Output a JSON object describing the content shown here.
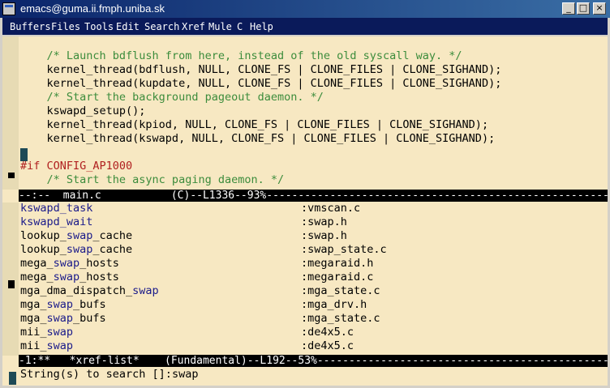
{
  "window": {
    "title": "emacs@guma.ii.fmph.uniba.sk"
  },
  "titlebar_buttons": {
    "minimize": "_",
    "maximize": "□",
    "close": "×"
  },
  "menubar": {
    "items": [
      "Buffers",
      "Files",
      "Tools",
      "Edit",
      "Search",
      "Xref",
      "Mule",
      "C",
      "Help"
    ]
  },
  "top_window": {
    "lines": [
      "",
      "    /* Launch bdflush from here, instead of the old syscall way. */",
      "    kernel_thread(bdflush, NULL, CLONE_FS | CLONE_FILES | CLONE_SIGHAND);",
      "    kernel_thread(kupdate, NULL, CLONE_FS | CLONE_FILES | CLONE_SIGHAND);",
      "    /* Start the background pageout daemon. */",
      "    kswapd_setup();",
      "    kernel_thread(kpiod, NULL, CLONE_FS | CLONE_FILES | CLONE_SIGHAND);",
      "    kernel_thread(kswapd, NULL, CLONE_FS | CLONE_FILES | CLONE_SIGHAND);",
      "",
      "#if CONFIG_AP1000",
      "    /* Start the async paging daemon. */"
    ],
    "modeline": "--:--  main.c           (C)--L1336--93%----------------------------------------------------------------------"
  },
  "xref_list": {
    "rows": [
      {
        "symbol": "kswapd_task",
        "file": ":vmscan.c"
      },
      {
        "symbol": "kswapd_wait",
        "file": ":swap.h"
      },
      {
        "symbol": "lookup_swap_cache",
        "file": ":swap.h"
      },
      {
        "symbol": "lookup_swap_cache",
        "file": ":swap_state.c"
      },
      {
        "symbol": "mega_swap_hosts",
        "file": ":megaraid.h"
      },
      {
        "symbol": "mega_swap_hosts",
        "file": ":megaraid.c"
      },
      {
        "symbol": "mga_dma_dispatch_swap",
        "file": ":mga_state.c"
      },
      {
        "symbol": "mga_swap_bufs",
        "file": ":mga_drv.h"
      },
      {
        "symbol": "mga_swap_bufs",
        "file": ":mga_state.c"
      },
      {
        "symbol": "mii_swap",
        "file": ":de4x5.c"
      },
      {
        "symbol": "mii_swap",
        "file": ":de4x5.c"
      }
    ],
    "modeline": "-1:**   *xref-list*    (Fundamental)--L192--53%------------------------------------------------------------"
  },
  "minibuffer": {
    "prompt": "String(s) to search []:",
    "value": "swap"
  }
}
